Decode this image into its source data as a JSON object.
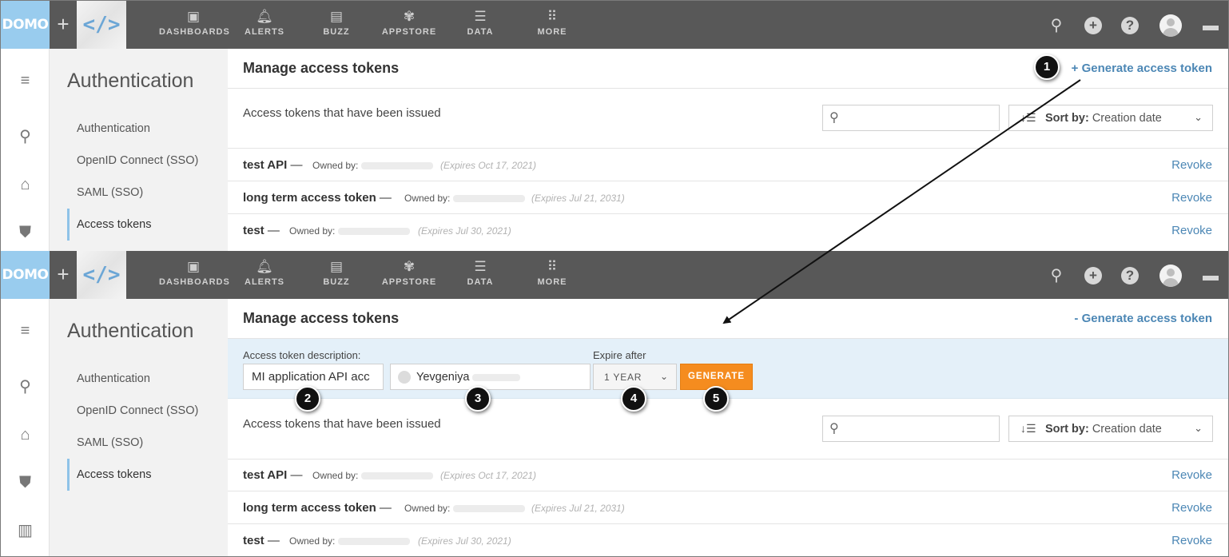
{
  "topnav": {
    "logo": "DOMO",
    "plus": "+",
    "dev_glyph": "</>",
    "items": [
      {
        "label": "DASHBOARDS",
        "icon": "dashboard-icon"
      },
      {
        "label": "ALERTS",
        "icon": "bell-icon"
      },
      {
        "label": "BUZZ",
        "icon": "chat-icon"
      },
      {
        "label": "APPSTORE",
        "icon": "appstore-icon"
      },
      {
        "label": "DATA",
        "icon": "database-icon"
      },
      {
        "label": "MORE",
        "icon": "grid-icon"
      }
    ],
    "right_icons": [
      "search-icon",
      "add-icon",
      "help-icon",
      "avatar",
      "messages-icon"
    ]
  },
  "sidebar": {
    "title": "Authentication",
    "items": [
      {
        "label": "Authentication",
        "active": false
      },
      {
        "label": "OpenID Connect (SSO)",
        "active": false
      },
      {
        "label": "SAML (SSO)",
        "active": false
      },
      {
        "label": "Access tokens",
        "active": true
      }
    ]
  },
  "top": {
    "page_title": "Manage access tokens",
    "generate_link": "+ Generate access token",
    "issued_label": "Access tokens that have been issued",
    "sort_prefix": "Sort by:",
    "sort_value": "Creation date"
  },
  "bottom": {
    "page_title": "Manage access tokens",
    "generate_link": "- Generate access token",
    "form": {
      "desc_label": "Access token description:",
      "desc_value": "MI application API acc",
      "owner_name": "Yevgeniya",
      "expire_label": "Expire after",
      "expire_value": "1 YEAR",
      "generate_button": "GENERATE"
    },
    "issued_label": "Access tokens that have been issued",
    "sort_prefix": "Sort by:",
    "sort_value": "Creation date"
  },
  "tokens": [
    {
      "name": "test API",
      "sep": "—",
      "owned_label": "Owned by:",
      "expires": "(Expires Oct 17, 2021)",
      "revoke": "Revoke"
    },
    {
      "name": "long term access token",
      "sep": "—",
      "owned_label": "Owned by:",
      "expires": "(Expires Jul 21, 2031)",
      "revoke": "Revoke"
    },
    {
      "name": "test",
      "sep": "—",
      "owned_label": "Owned by:",
      "expires": "(Expires Jul 30, 2021)",
      "revoke": "Revoke"
    }
  ],
  "callouts": [
    "1",
    "2",
    "3",
    "4",
    "5"
  ],
  "colors": {
    "topbar": "#585858",
    "logo_bg": "#99ccee",
    "link": "#4c87b5",
    "generate_button": "#f58c1f",
    "form_bg": "#e4f0f9",
    "sidebar_bg": "#f2f2f2",
    "active_accent": "#8ec2e8"
  }
}
